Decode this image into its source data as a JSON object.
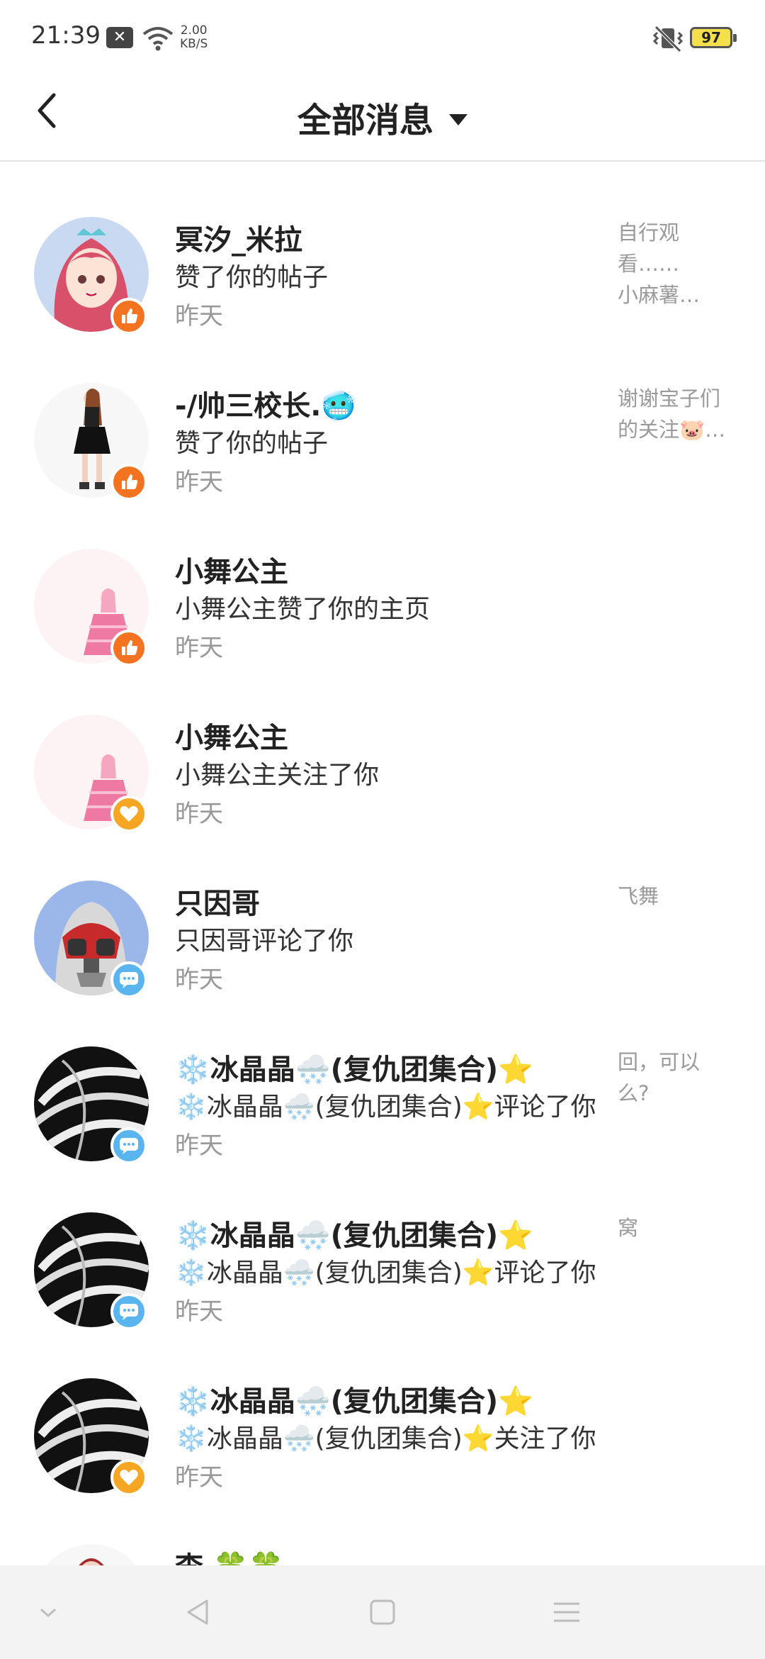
{
  "status_bar": {
    "time": "21:39",
    "notif_icon": "x-icon",
    "speed_value": "2.00",
    "speed_unit": "KB/S",
    "battery": "97"
  },
  "header": {
    "title": "全部消息",
    "back_icon": "back-chevron-icon",
    "dropdown_icon": "triangle-down-icon"
  },
  "messages": [
    {
      "name": "冥汐_米拉",
      "action": "赞了你的帖子",
      "time": "昨天",
      "preview": "自行观看……\n小麻薯…",
      "badge": "like",
      "avatar": "pink-hair-girl"
    },
    {
      "name": "-/帅三校长.🥶",
      "action": "赞了你的帖子",
      "time": "昨天",
      "preview": "谢谢宝子们\n的关注🐷…",
      "badge": "like",
      "avatar": "dancer-girl"
    },
    {
      "name": "小舞公主",
      "action": "小舞公主赞了你的主页",
      "time": "昨天",
      "preview": "",
      "badge": "like",
      "avatar": "princess-pink-dress"
    },
    {
      "name": "小舞公主",
      "action": "小舞公主关注了你",
      "time": "昨天",
      "preview": "",
      "badge": "follow",
      "avatar": "princess-pink-dress"
    },
    {
      "name": "只因哥",
      "action": "只因哥评论了你",
      "time": "昨天",
      "preview": "飞舞",
      "badge": "comment",
      "avatar": "antman-helmet"
    },
    {
      "name": "❄️冰晶晶🌨️(复仇团集合)⭐",
      "action": "❄️冰晶晶🌨️(复仇团集合)⭐评论了你",
      "time": "昨天",
      "preview": "回，可以\n么?",
      "badge": "comment",
      "avatar": "zebra-swirl"
    },
    {
      "name": "❄️冰晶晶🌨️(复仇团集合)⭐",
      "action": "❄️冰晶晶🌨️(复仇团集合)⭐评论了你",
      "time": "昨天",
      "preview": "窝",
      "badge": "comment",
      "avatar": "zebra-swirl"
    },
    {
      "name": "❄️冰晶晶🌨️(复仇团集合)⭐",
      "action": "❄️冰晶晶🌨️(复仇团集合)⭐关注了你",
      "time": "昨天",
      "preview": "",
      "badge": "follow",
      "avatar": "zebra-swirl"
    },
    {
      "name": "李 🍀🍀",
      "action": "",
      "time": "",
      "preview": "",
      "badge": "",
      "avatar": "red-hair-girl"
    }
  ],
  "colors": {
    "like_badge": "#f47321",
    "follow_badge": "#f5a623",
    "comment_badge": "#5ab4ee",
    "secondary_text": "#999999"
  },
  "nav_bar": {
    "items": [
      "chevron-down-icon",
      "back-triangle-icon",
      "home-square-icon",
      "menu-lines-icon"
    ]
  }
}
